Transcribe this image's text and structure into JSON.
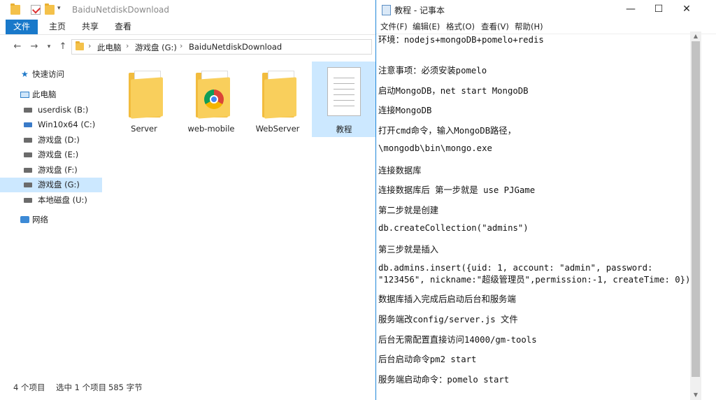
{
  "explorer": {
    "title": "BaiduNetdiskDownload",
    "ribbon_tabs": [
      "文件",
      "主页",
      "共享",
      "查看"
    ],
    "address": {
      "crumbs": [
        "此电脑",
        "游戏盘 (G:)",
        "BaiduNetdiskDownload"
      ]
    },
    "nav": {
      "quick_access": "快速访问",
      "this_pc": "此电脑",
      "drives": [
        {
          "label": "userdisk (B:)"
        },
        {
          "label": "Win10x64 (C:)"
        },
        {
          "label": "游戏盘 (D:)"
        },
        {
          "label": "游戏盘 (E:)"
        },
        {
          "label": "游戏盘 (F:)"
        },
        {
          "label": "游戏盘 (G:)"
        },
        {
          "label": "本地磁盘 (U:)"
        }
      ],
      "network": "网络"
    },
    "files": [
      {
        "name": "Server",
        "type": "folder"
      },
      {
        "name": "web-mobile",
        "type": "chrome-folder"
      },
      {
        "name": "WebServer",
        "type": "folder"
      },
      {
        "name": "教程",
        "type": "text-document"
      }
    ],
    "status": {
      "count": "4 个项目",
      "selected": "选中 1 个项目",
      "size": "585 字节"
    }
  },
  "notepad": {
    "title": "教程 - 记事本",
    "menu": [
      "文件(F)",
      "编辑(E)",
      "格式(O)",
      "查看(V)",
      "帮助(H)"
    ],
    "lines": [
      "环境：nodejs+mongoDB+pomelo+redis",
      "注意事项：必须安装pomelo",
      "启动MongoDB，net start MongoDB",
      "连接MongoDB",
      "打开cmd命令，输入MongoDB路径，",
      "\\mongodb\\bin\\mongo.exe",
      "连接数据库",
      "连接数据库后 第一步就是 use PJGame",
      "第二步就是创建",
      "db.createCollection(\"admins\")",
      "第三步就是插入",
      "db.admins.insert({uid: 1, account: \"admin\", password:",
      "\"123456\", nickname:\"超级管理员\",permission:-1, createTime: 0})",
      "数据库插入完成后启动后台和服务端",
      "服务端改config/server.js 文件",
      "后台无需配置直接访问14000/gm-tools",
      "后台启动命令pm2 start",
      "服务端启动命令：pomelo start"
    ]
  }
}
